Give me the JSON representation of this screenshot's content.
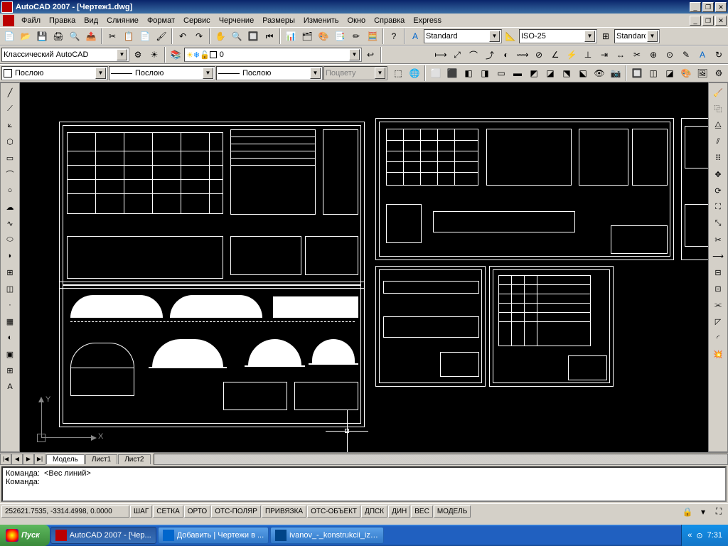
{
  "title": "AutoCAD 2007 - [Чертеж1.dwg]",
  "menu": [
    "Файл",
    "Правка",
    "Вид",
    "Слияние",
    "Формат",
    "Сервис",
    "Черчение",
    "Размеры",
    "Изменить",
    "Окно",
    "Справка",
    "Express"
  ],
  "toolbar2": {
    "textstyle": "Standard",
    "dimstyle": "ISO-25",
    "tablestyle": "Standard"
  },
  "toolbar3": {
    "workspace": "Классический AutoCAD",
    "layer": "0"
  },
  "toolbar4": {
    "color": "Послою",
    "ltype": "Послою",
    "lweight": "Послою",
    "plotstyle": "Поцвету"
  },
  "canvas": {
    "ucs_x": "X",
    "ucs_y": "Y"
  },
  "tabs": {
    "model": "Модель",
    "l1": "Лист1",
    "l2": "Лист2"
  },
  "cmd": {
    "line1": "Команда:  <Вес линий>",
    "line2": "Команда:"
  },
  "status": {
    "coords": "252621.7535, -3314.4998, 0.0000",
    "buttons": [
      "ШАГ",
      "СЕТКА",
      "ОРТО",
      "ОТС-ПОЛЯР",
      "ПРИВЯЗКА",
      "ОТС-ОБЪЕКТ",
      "ДПСК",
      "ДИН",
      "ВЕС",
      "МОДЕЛЬ"
    ]
  },
  "taskbar": {
    "start": "Пуск",
    "items": [
      "AutoCAD 2007 - [Чер...",
      "Добавить | Чертежи в ...",
      "ivanov_-_konstrukcii_iz_..."
    ],
    "time": "7:31"
  }
}
